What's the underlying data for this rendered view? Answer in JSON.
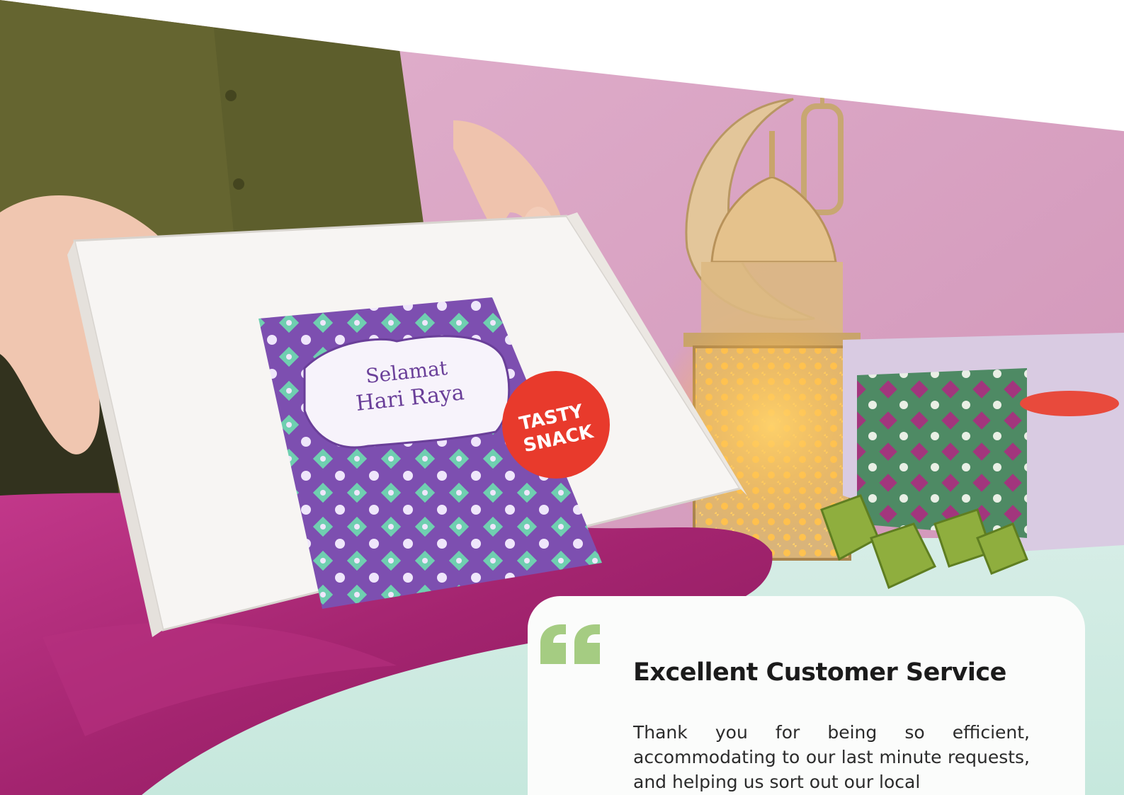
{
  "testimonial": {
    "title": "Excellent Customer Service",
    "body": "Thank you for being so efficient, accommodating to our last minute requests, and helping us sort out our local",
    "quote_color": "#a5cc82"
  },
  "photo": {
    "box_greeting_line1": "Selamat",
    "box_greeting_line2": "Hari Raya",
    "brand_sticker_line1": "TASTY",
    "brand_sticker_line2": "SNACK"
  },
  "colors": {
    "accent_green": "#a5cc82",
    "wall_pink": "#d7a1c0",
    "cloth_magenta": "#a3246f",
    "pattern_purple": "#7d4fb0",
    "pattern_mint": "#6fcfb0",
    "sticker_red": "#e83a2c"
  }
}
